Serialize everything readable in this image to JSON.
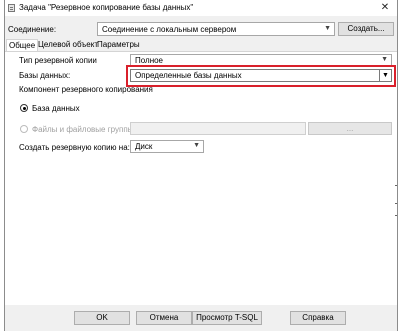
{
  "window": {
    "title": "Задача \"Резервное копирование базы данных\"",
    "close_glyph": "✕"
  },
  "connection": {
    "label": "Соединение:",
    "value": "Соединение с локальным сервером",
    "create_button": "Создать..."
  },
  "tabs": [
    {
      "label": "Общее",
      "active": true
    },
    {
      "label": "Целевой объект",
      "active": false
    },
    {
      "label": "Параметры",
      "active": false
    }
  ],
  "general": {
    "backup_type_label": "Тип резервной копии",
    "backup_type_value": "Полное",
    "databases_label": "Базы данных:",
    "databases_value": "Определенные базы данных",
    "component_label": "Компонент резервного копирования",
    "radio_database": "База данных",
    "radio_database_checked": true,
    "radio_files": "Файлы и файловые группы:",
    "radio_files_checked": false,
    "files_browse_button": "...",
    "create_backup_on_label": "Создать резервную копию на:",
    "create_backup_on_value": "Диск"
  },
  "footer": {
    "ok": "OK",
    "cancel": "Отмена",
    "view_tsql": "Просмотр T-SQL",
    "help": "Справка"
  },
  "colors": {
    "highlight": "#d9202b",
    "window_bg": "#f0f0f0"
  },
  "icons": {
    "dropdown": "chevron-down-icon",
    "close": "close-icon",
    "title": "task-icon"
  }
}
